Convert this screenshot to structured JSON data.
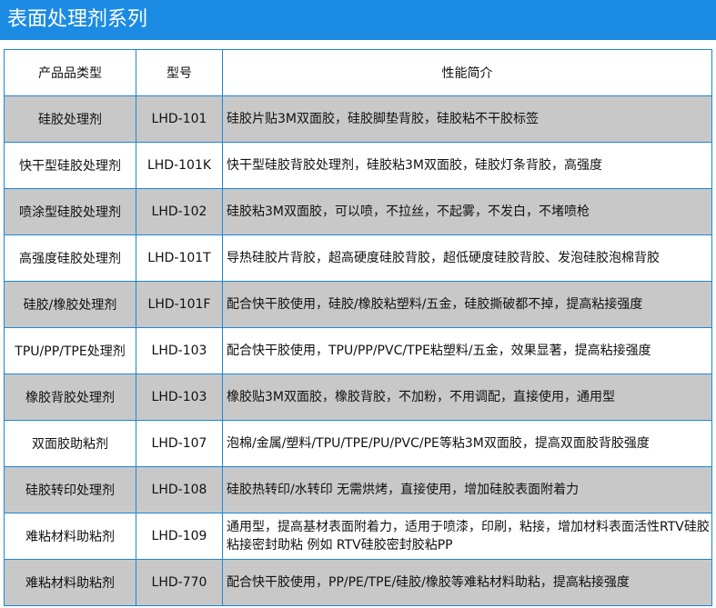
{
  "header": {
    "title": "表面处理剂系列"
  },
  "table": {
    "columns": [
      "产品品类型",
      "型号",
      "性能简介"
    ],
    "rows": [
      {
        "name": "硅胶处理剂",
        "model": "LHD-101",
        "desc": "硅胶片贴3M双面胶，硅胶脚垫背胶，硅胶粘不干胶标签"
      },
      {
        "name": "快干型硅胶处理剂",
        "model": "LHD-101K",
        "desc": "快干型硅胶背胶处理剂，硅胶粘3M双面胶，硅胶灯条背胶，高强度"
      },
      {
        "name": "喷涂型硅胶处理剂",
        "model": "LHD-102",
        "desc": "硅胶粘3M双面胶，可以喷，不拉丝，不起雾，不发白，不堵喷枪"
      },
      {
        "name": "高强度硅胶处理剂",
        "model": "LHD-101T",
        "desc": "导热硅胶片背胶，超高硬度硅胶背胶，超低硬度硅胶背胶、发泡硅胶泡棉背胶"
      },
      {
        "name": "硅胶/橡胶处理剂",
        "model": "LHD-101F",
        "desc": "配合快干胶使用，硅胶/橡胶粘塑料/五金，硅胶撕破都不掉，提高粘接强度"
      },
      {
        "name": "TPU/PP/TPE处理剂",
        "model": "LHD-103",
        "desc": "配合快干胶使用，TPU/PP/PVC/TPE粘塑料/五金，效果显著，提高粘接强度"
      },
      {
        "name": "橡胶背胶处理剂",
        "model": "LHD-103",
        "desc": "橡胶贴3M双面胶，橡胶背胶，不加粉，不用调配，直接使用，通用型"
      },
      {
        "name": "双面胶助粘剂",
        "model": "LHD-107",
        "desc": "泡棉/金属/塑料/TPU/TPE/PU/PVC/PE等粘3M双面胶，提高双面胶背胶强度"
      },
      {
        "name": "硅胶转印处理剂",
        "model": "LHD-108",
        "desc": "硅胶热转印/水转印 无需烘烤，直接使用，增加硅胶表面附着力"
      },
      {
        "name": "难粘材料助粘剂",
        "model": "LHD-109",
        "desc": "通用型，提高基材表面附着力，适用于喷漆，印刷，粘接，增加材料表面活性RTV硅胶粘接密封助粘 例如 RTV硅胶密封胶粘PP"
      },
      {
        "name": "难粘材料助粘剂",
        "model": "LHD-770",
        "desc": "配合快干胶使用，PP/PE/TPE/硅胶/橡胶等难粘材料助粘，提高粘接强度"
      }
    ]
  }
}
